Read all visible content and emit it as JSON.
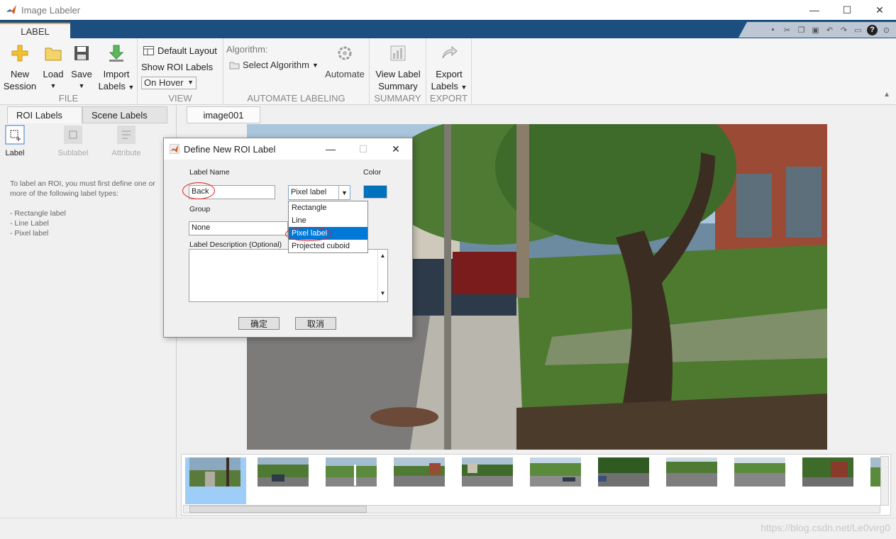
{
  "window": {
    "title": "Image Labeler",
    "minimize": "—",
    "maximize": "☐",
    "close": "✕"
  },
  "ribbon_tab": {
    "label": "LABEL"
  },
  "ribbon": {
    "file": {
      "title": "FILE",
      "new_line1": "New",
      "new_line2": "Session",
      "load": "Load",
      "save": "Save",
      "import_line1": "Import",
      "import_line2": "Labels"
    },
    "view": {
      "title": "VIEW",
      "default_layout": "Default Layout",
      "show_roi_labels": "Show ROI Labels",
      "on_hover": "On Hover"
    },
    "automate": {
      "title": "AUTOMATE LABELING",
      "algorithm_label": "Algorithm:",
      "select_algorithm": "Select Algorithm",
      "automate": "Automate"
    },
    "summary": {
      "title": "SUMMARY",
      "line1": "View Label",
      "line2": "Summary"
    },
    "export": {
      "title": "EXPORT",
      "line1": "Export",
      "line2": "Labels"
    }
  },
  "left_panel": {
    "tabs": [
      "ROI Labels",
      "Scene Labels"
    ],
    "tools": {
      "label": "Label",
      "sublabel": "Sublabel",
      "attribute": "Attribute"
    },
    "help_line1": "To label an ROI, you must first define one or more of the following label types:",
    "help_items": [
      "- Rectangle label",
      "- Line Label",
      "- Pixel label"
    ]
  },
  "main": {
    "image_tab": "image001"
  },
  "dialog": {
    "title": "Define New ROI Label",
    "label_name_caption": "Label Name",
    "label_name_value": "Back",
    "type_selected": "Pixel label",
    "color_caption": "Color",
    "color_value": "#0072bd",
    "group_caption": "Group",
    "group_value": "None",
    "description_caption": "Label Description (Optional)",
    "ok": "确定",
    "cancel": "取消",
    "type_options": [
      "Rectangle",
      "Line",
      "Pixel label",
      "Projected cuboid"
    ]
  },
  "watermark": "https://blog.csdn.net/Le0virg0"
}
